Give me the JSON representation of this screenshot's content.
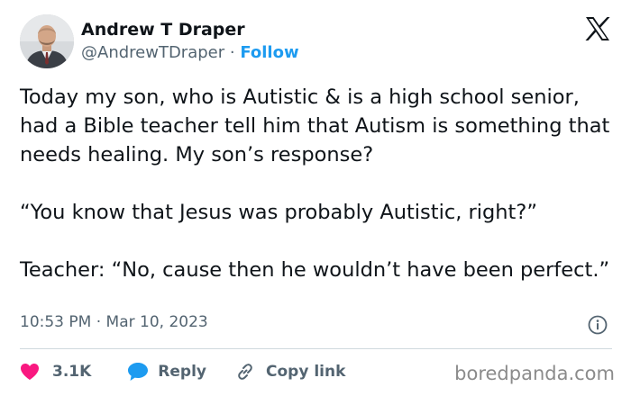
{
  "author": {
    "name": "Andrew T Draper",
    "handle": "@AndrewTDraper",
    "separator": " · ",
    "follow_label": "Follow",
    "avatar_icon": "profile-photo"
  },
  "platform_icon": "x-logo-icon",
  "tweet": {
    "text": "Today my son, who is Autistic & is a high school senior, had a Bible teacher tell him that Autism is something that needs healing. My son’s response?\n\n“You know that Jesus was probably Autistic, right?”\n\nTeacher: “No, cause then he wouldn’t have been perfect.”",
    "timestamp": "10:53 PM · Mar 10, 2023"
  },
  "actions": {
    "like_count": "3.1K",
    "reply_label": "Reply",
    "copy_link_label": "Copy link"
  },
  "colors": {
    "accent": "#1d9bf0",
    "like": "#f91880",
    "muted": "#536471"
  },
  "watermark": "boredpanda.com"
}
